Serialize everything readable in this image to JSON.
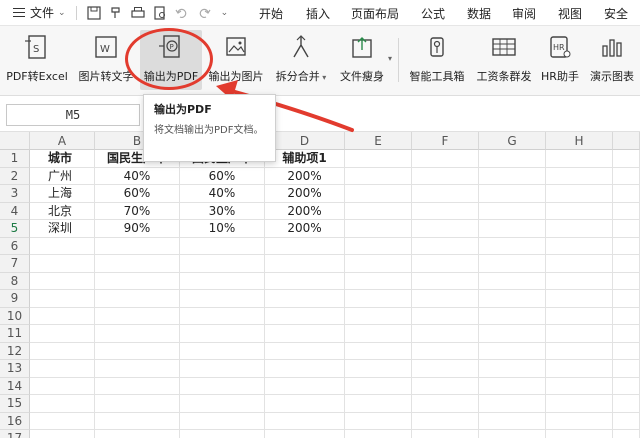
{
  "menubar": {
    "file_label": "文件",
    "tabs": [
      "开始",
      "插入",
      "页面布局",
      "公式",
      "数据",
      "审阅",
      "视图",
      "安全"
    ]
  },
  "ribbon": {
    "buttons": [
      {
        "label": "PDF转Excel",
        "icon": "pdf-to-excel-icon"
      },
      {
        "label": "图片转文字",
        "icon": "image-to-text-icon"
      },
      {
        "label": "输出为PDF",
        "icon": "export-pdf-icon"
      },
      {
        "label": "输出为图片",
        "icon": "export-image-icon"
      },
      {
        "label": "拆分合并",
        "icon": "split-merge-icon"
      },
      {
        "label": "文件瘦身",
        "icon": "file-slim-icon"
      },
      {
        "label": "智能工具箱",
        "icon": "smart-toolbox-icon"
      },
      {
        "label": "工资条群发",
        "icon": "payslip-icon"
      },
      {
        "label": "HR助手",
        "icon": "hr-assistant-icon"
      },
      {
        "label": "演示图表",
        "icon": "demo-chart-icon"
      }
    ]
  },
  "tooltip": {
    "title": "输出为PDF",
    "body": "将文档输出为PDF文档。"
  },
  "namebox": "M5",
  "columns": [
    "A",
    "B",
    "C",
    "D",
    "E",
    "F",
    "G",
    "H"
  ],
  "rows": [
    "1",
    "2",
    "3",
    "4",
    "5",
    "6",
    "7",
    "8",
    "9",
    "10",
    "11",
    "12",
    "13",
    "14",
    "15",
    "16",
    "17"
  ],
  "table": {
    "headers": [
      "城市",
      "国民生产率",
      "国民生产率",
      "辅助项1"
    ],
    "rows": [
      [
        "广州",
        "40%",
        "60%",
        "200%"
      ],
      [
        "上海",
        "60%",
        "40%",
        "200%"
      ],
      [
        "北京",
        "70%",
        "30%",
        "200%"
      ],
      [
        "深圳",
        "90%",
        "10%",
        "200%"
      ]
    ]
  },
  "colors": {
    "highlight": "#e23b2e",
    "accent": "#1e7b45"
  }
}
